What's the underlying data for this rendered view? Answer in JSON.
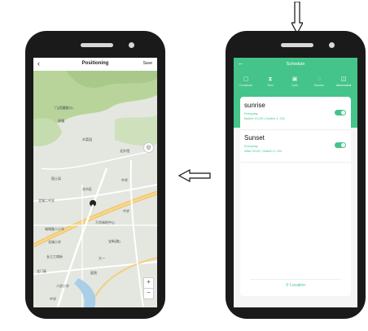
{
  "positioning": {
    "back_icon": "‹",
    "title": "Positioning",
    "save_label": "Save",
    "map_labels": [
      "门(西藏路口)",
      "苏镇",
      "许菜园",
      "北外馆",
      "国土局",
      "北市区",
      "中学",
      "北城二中学",
      "中学",
      "万华体检中心",
      "城城路二小学",
      "北城小学",
      "宝新(路)",
      "长江工商街",
      "大一",
      "北门高",
      "人民小学",
      "医院",
      "中学"
    ],
    "zoom_in": "+",
    "zoom_out": "−"
  },
  "schedule": {
    "back_icon": "←",
    "title": "Schedule",
    "tabs": [
      "Countdown",
      "Timer",
      "Cycle",
      "Random",
      "Astronomical"
    ],
    "items": [
      {
        "name": "sunrise",
        "repeat": "Everyday",
        "detail": "Before 01:00 | Switch 1: ON"
      },
      {
        "name": "Sunset",
        "repeat": "Everyday",
        "detail": "After 02:00 | Switch 1: ON"
      }
    ],
    "location_label": "Location"
  }
}
